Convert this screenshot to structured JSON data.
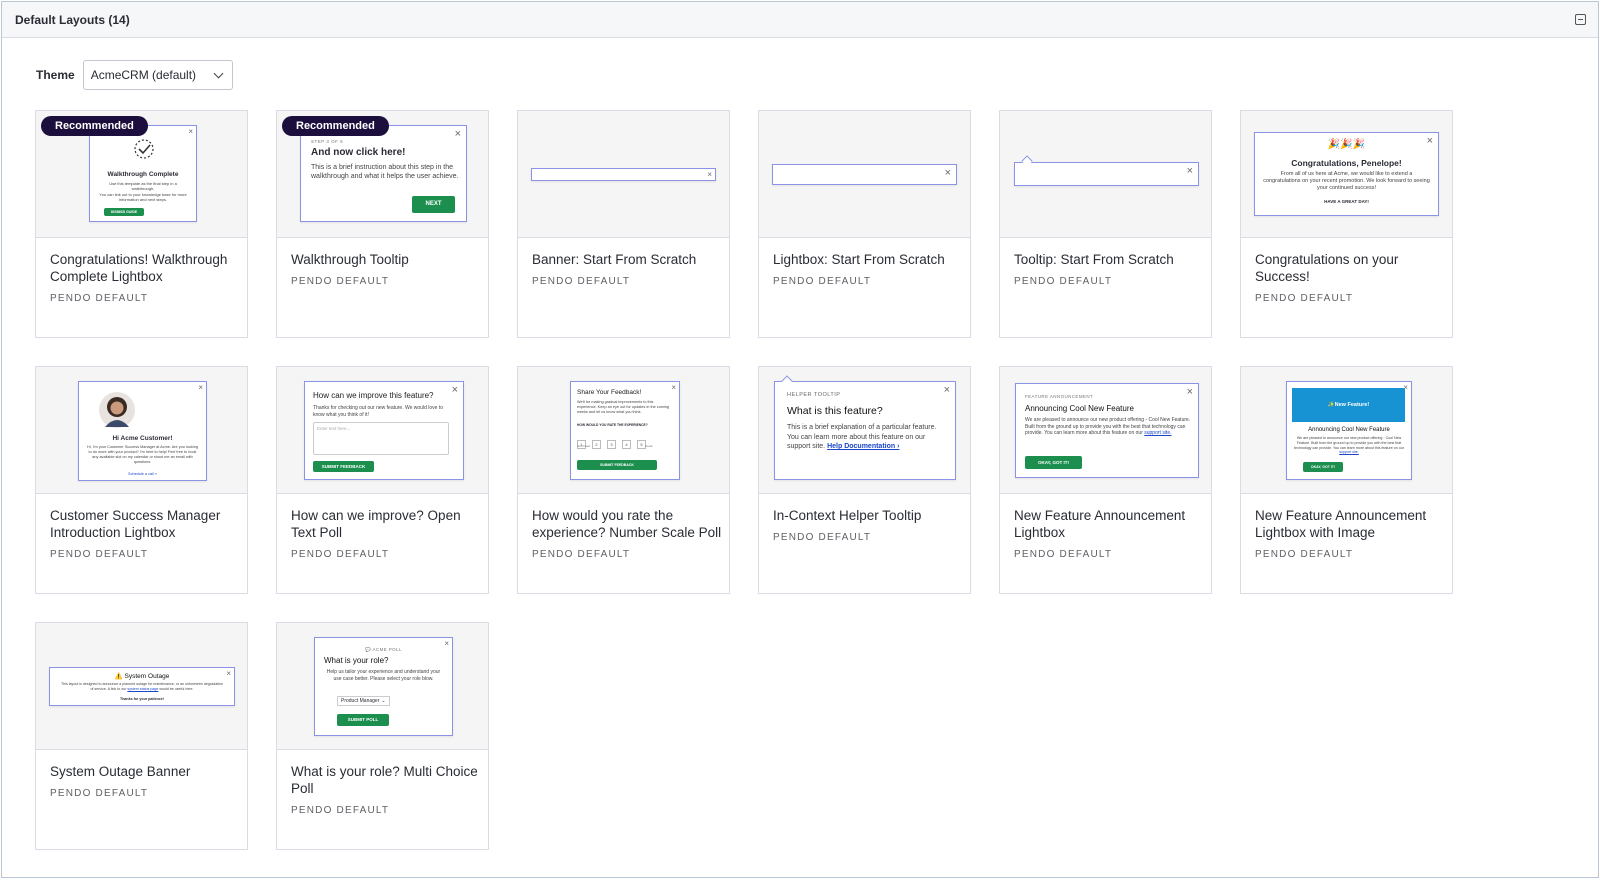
{
  "header": {
    "title": "Default Layouts (14)"
  },
  "theme": {
    "label": "Theme",
    "selected": "AcmeCRM (default)"
  },
  "badge_text": "Recommended",
  "cards": [
    {
      "title": "Congratulations! Walkthrough Complete Lightbox",
      "sub": "PENDO DEFAULT",
      "preview": {
        "heading": "Walkthrough Complete",
        "text1": "Use this template as the final step in a walkthrough.",
        "text2": "You can link out to your knowledge base for more information and next steps.",
        "button": "DISMISS GUIDE"
      }
    },
    {
      "title": "Walkthrough Tooltip",
      "sub": "PENDO DEFAULT",
      "preview": {
        "step": "STEP 3 OF 5",
        "heading": "And now click here!",
        "text": "This is a brief instruction about this step in the walkthrough and what it helps the user achieve.",
        "button": "NEXT"
      }
    },
    {
      "title": "Banner: Start From Scratch",
      "sub": "PENDO DEFAULT"
    },
    {
      "title": "Lightbox: Start From Scratch",
      "sub": "PENDO DEFAULT"
    },
    {
      "title": "Tooltip: Start From Scratch",
      "sub": "PENDO DEFAULT"
    },
    {
      "title": "Congratulations on your Success!",
      "sub": "PENDO DEFAULT",
      "preview": {
        "emoji": "🎉🎉🎉",
        "heading": "Congratulations, Penelope!",
        "text": "From all of us here at Acme, we would like to extend a congratulations on your recent promotion. We look forward to seeing your continued success!",
        "footer": "HAVE A GREAT DAY!"
      }
    },
    {
      "title": "Customer Success Manager Introduction Lightbox",
      "sub": "PENDO DEFAULT",
      "preview": {
        "heading": "Hi Acme Customer!",
        "text": "Hi, I'm your Customer Success Manager at Acme. Are you looking to do more with your product? I'm here to help! Feel free to book any available slot on my calendar or shoot me an email with questions.",
        "link": "Schedule a call »"
      }
    },
    {
      "title": "How can we improve? Open Text Poll",
      "sub": "PENDO DEFAULT",
      "preview": {
        "heading": "How can we improve this feature?",
        "text": "Thanks for checking out our new feature. We would love to know what you think of it!",
        "placeholder": "Enter text here...",
        "button": "SUBMIT FEEDBACK"
      }
    },
    {
      "title": "How would you rate the experience? Number Scale Poll",
      "sub": "PENDO DEFAULT",
      "preview": {
        "heading": "Share Your Feedback!",
        "text": "We'll be making gradual improvements to this experience. Keep an eye out for updates in the coming weeks and let us know what you think.",
        "question": "HOW WOULD YOU RATE THE EXPERIENCE?",
        "scale": [
          "1",
          "2",
          "3",
          "4",
          "5"
        ],
        "low": "Not Great",
        "high": "Great",
        "button": "SUBMIT FEEDBACK"
      }
    },
    {
      "title": "In-Context Helper Tooltip",
      "sub": "PENDO DEFAULT",
      "preview": {
        "eyebrow": "HELPER TOOLTIP",
        "heading": "What is this feature?",
        "text": "This is a brief explanation of a particular feature. You can learn more about this feature on our support site.",
        "link": "Help Documentation ›"
      }
    },
    {
      "title": "New Feature Announcement Lightbox",
      "sub": "PENDO DEFAULT",
      "preview": {
        "eyebrow": "FEATURE ANNOUNCEMENT",
        "heading": "Announcing Cool New Feature",
        "text": "We are pleased to announce our new product offering - Cool New Feature. Built from the ground up to provide you with the best that technology can provide. You can learn more about this feature on our",
        "link": "support site.",
        "button": "OKAY, GOT IT!"
      }
    },
    {
      "title": "New Feature Announcement Lightbox with Image",
      "sub": "PENDO DEFAULT",
      "preview": {
        "image_text": "✨New Feature!",
        "heading": "Announcing Cool New Feature",
        "text": "We are pleased to announce our new product offering - Cool New Feature. Built from the ground up to provide you with the best that technology can provide. You can learn more about this feature on our",
        "link": "support site.",
        "button": "OKAY, GOT IT!"
      }
    },
    {
      "title": "System Outage Banner",
      "sub": "PENDO DEFAULT",
      "preview": {
        "heading": "⚠️ System Outage",
        "text": "This layout is designed to announce a planned outage for maintenance, or an unforeseen degradation of service. A link to our",
        "link": "system status page",
        "text2": "would be useful here.",
        "footer": "Thanks for your patience!"
      }
    },
    {
      "title": "What is your role? Multi Choice Poll",
      "sub": "PENDO DEFAULT",
      "preview": {
        "eyebrow": "💬 ACME POLL",
        "heading": "What is your role?",
        "text": "Help us tailor your experience and understand your use case better. Please select your role blow.",
        "select": "Product Manager",
        "button": "SUBMIT POLL"
      }
    }
  ],
  "close_glyph": "×",
  "colors": {
    "accent_green": "#1c8f4e",
    "badge_navy": "#1d0f3d",
    "preview_border": "#8b93e6",
    "image_blue": "#1792d2"
  }
}
